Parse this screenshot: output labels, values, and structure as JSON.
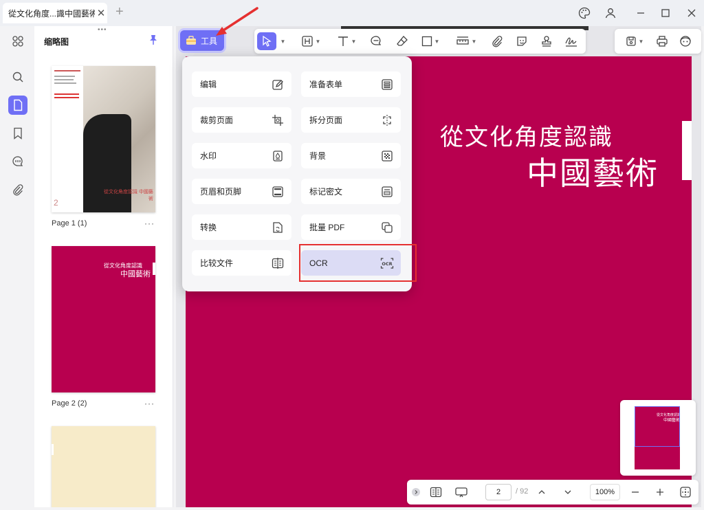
{
  "window": {
    "tab_title": "從文化角度...識中國藝術",
    "close_tab": "✕",
    "new_tab": "+"
  },
  "thumbnails": {
    "title": "缩略图",
    "pages": [
      {
        "label": "Page 1 (1)",
        "cover_number": "2",
        "cover_text": "從文化角度認識 中國藝術",
        "more": "···"
      },
      {
        "label": "Page 2 (2)",
        "cover_line1": "從文化角度認識",
        "cover_line2": "中國藝術",
        "more": "···"
      },
      {
        "label": "",
        "more": ""
      }
    ]
  },
  "toolbar": {
    "tools_label": "工具"
  },
  "page": {
    "title_line1": "從文化角度認識",
    "title_line2": "中國藝術",
    "background": "#b8004f"
  },
  "menu": {
    "items": [
      {
        "label": "编辑",
        "icon": "edit-icon"
      },
      {
        "label": "准备表单",
        "icon": "form-icon"
      },
      {
        "label": "裁剪页面",
        "icon": "crop-icon"
      },
      {
        "label": "拆分页面",
        "icon": "split-icon"
      },
      {
        "label": "水印",
        "icon": "watermark-icon"
      },
      {
        "label": "背景",
        "icon": "background-icon"
      },
      {
        "label": "页眉和页脚",
        "icon": "header-footer-icon"
      },
      {
        "label": "标记密文",
        "icon": "redact-icon"
      },
      {
        "label": "转换",
        "icon": "convert-icon"
      },
      {
        "label": "批量 PDF",
        "icon": "batch-icon"
      },
      {
        "label": "比较文件",
        "icon": "compare-icon"
      },
      {
        "label": "OCR",
        "icon": "ocr-icon"
      }
    ]
  },
  "bottom": {
    "current_page": "2",
    "total_pages": "/ 92",
    "zoom": "100%"
  },
  "minimap": {
    "line1": "從文化角度認識",
    "line2": "中國藝術"
  },
  "colors": {
    "accent": "#6f6ff5",
    "page": "#b8004f",
    "annotation": "#e53030"
  }
}
